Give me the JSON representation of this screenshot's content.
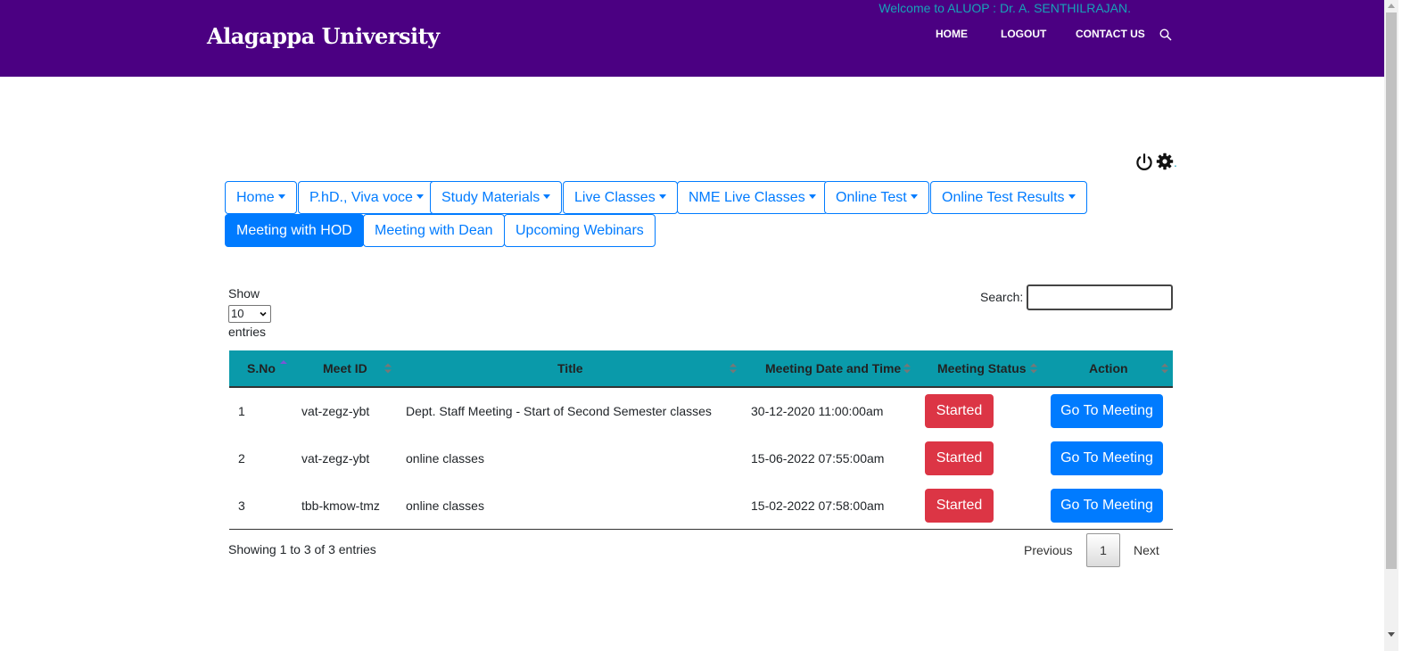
{
  "header": {
    "brand": "Alagappa University",
    "nav": [
      "HOME",
      "LOGOUT",
      "CONTACT US"
    ],
    "search_icon": "search-icon"
  },
  "welcome": {
    "text": "Welcome to ALUOP : Dr. A. SENTHILRAJAN.",
    "trailing": ".",
    "icons": [
      "power-icon",
      "gear-icon"
    ]
  },
  "menu": {
    "items": [
      {
        "label": "Home",
        "dropdown": true
      },
      {
        "label": "P.hD., Viva voce",
        "dropdown": true
      },
      {
        "label": "Study Materials",
        "dropdown": true
      },
      {
        "label": "Live Classes",
        "dropdown": true
      },
      {
        "label": "NME Live Classes",
        "dropdown": true
      },
      {
        "label": "Online Test",
        "dropdown": true
      },
      {
        "label": "Online Test Results",
        "dropdown": true
      },
      {
        "label": "Meeting with HOD",
        "dropdown": false,
        "active": true
      },
      {
        "label": "Meeting with Dean",
        "dropdown": false
      },
      {
        "label": "Upcoming Webinars",
        "dropdown": false
      }
    ]
  },
  "table_controls": {
    "show_label": "Show",
    "page_size": "10",
    "entries_label": "entries",
    "search_label": "Search:",
    "search_value": ""
  },
  "table": {
    "headers": [
      "S.No",
      "Meet ID",
      "Title",
      "Meeting Date and Time",
      "Meeting Status",
      "Action"
    ],
    "rows": [
      {
        "sno": "1",
        "meet_id": "vat-zegz-ybt",
        "title": "Dept. Staff Meeting - Start of Second Semester classes",
        "datetime": "30-12-2020 11:00:00am",
        "status": "Started",
        "action": "Go To Meeting"
      },
      {
        "sno": "2",
        "meet_id": "vat-zegz-ybt",
        "title": "online classes",
        "datetime": "15-06-2022 07:55:00am",
        "status": "Started",
        "action": "Go To Meeting"
      },
      {
        "sno": "3",
        "meet_id": "tbb-kmow-tmz",
        "title": "online classes",
        "datetime": "15-02-2022 07:58:00am",
        "status": "Started",
        "action": "Go To Meeting"
      }
    ]
  },
  "footer": {
    "info": "Showing 1 to 3 of 3 entries",
    "previous": "Previous",
    "current_page": "1",
    "next": "Next"
  },
  "colors": {
    "header_bg": "#4b0082",
    "primary": "#007bff",
    "danger": "#dc3545",
    "table_head": "#0a9aaa",
    "welcome_text": "#17a2b8"
  }
}
